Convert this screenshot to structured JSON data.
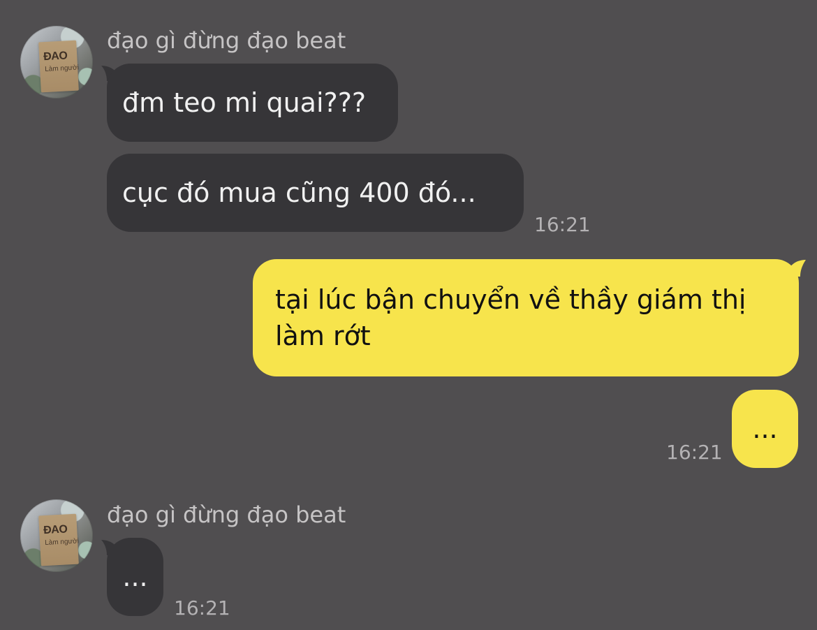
{
  "chat": {
    "contact_name": "đạo gì đừng đạo beat",
    "avatar": {
      "icon": "avatar-book-image",
      "title": "ĐAO",
      "subtitle": "Làm người"
    },
    "group1": {
      "sender": "đạo gì đừng đạo beat",
      "messages": [
        {
          "text": "đm teo mi quai???"
        },
        {
          "text": "cục đó mua cũng 400 đó..."
        }
      ],
      "time": "16:21"
    },
    "group2": {
      "messages": [
        {
          "text": "tại lúc bận chuyển về thầy giám thị làm rớt"
        },
        {
          "text": "..."
        }
      ],
      "time": "16:21"
    },
    "group3": {
      "sender": "đạo gì đừng đạo beat",
      "messages": [
        {
          "text": "..."
        }
      ],
      "time": "16:21"
    }
  }
}
